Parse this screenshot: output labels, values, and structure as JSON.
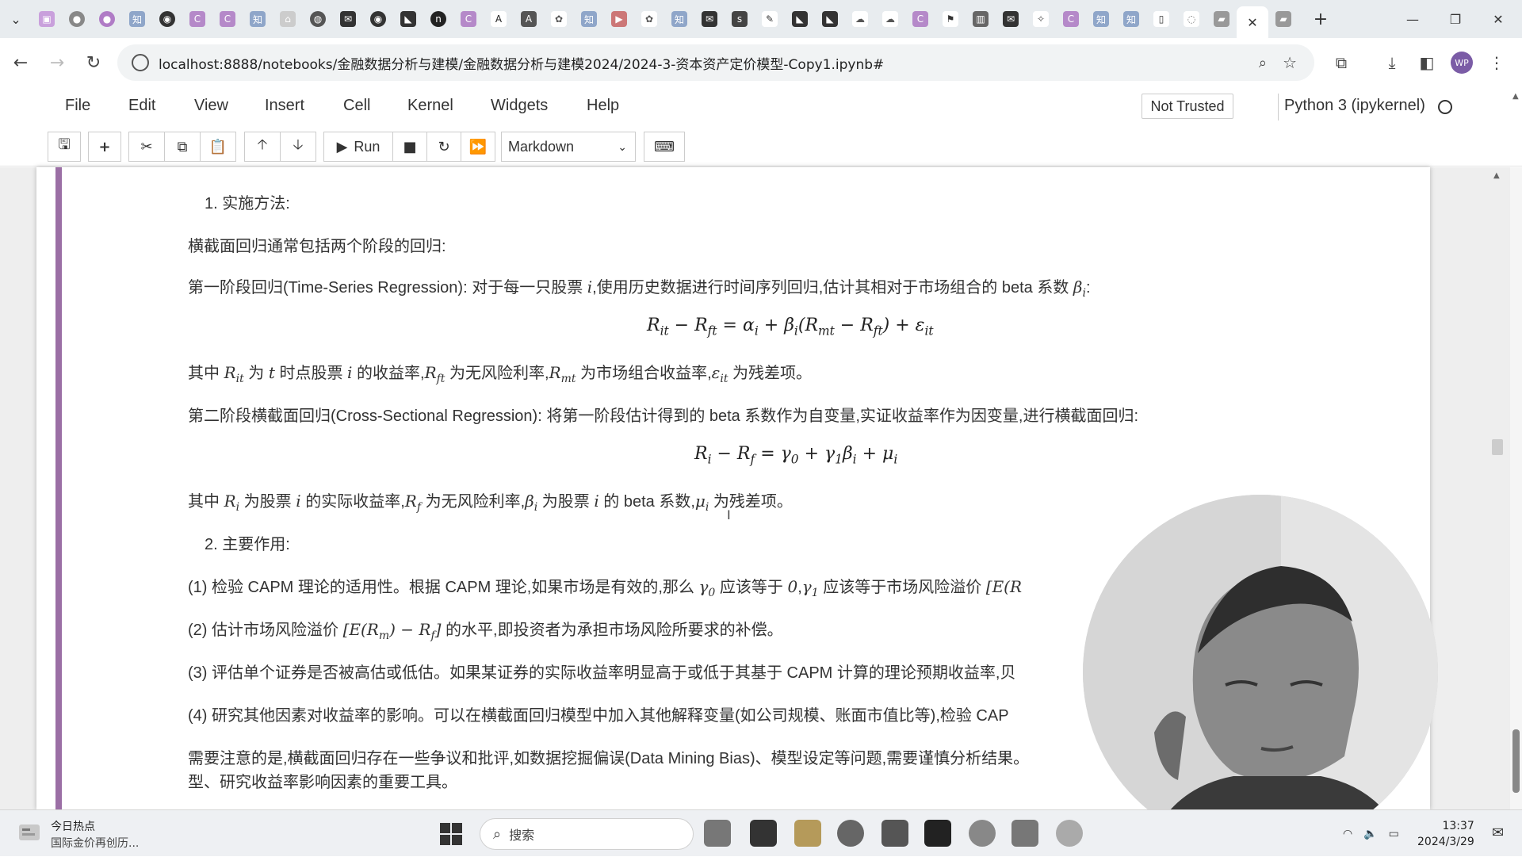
{
  "browser": {
    "url": "localhost:8888/notebooks/金融数据分析与建模/金融数据分析与建模2024/2024-3-资本资产定价模型-Copy1.ipynb#",
    "profile_initials": "WP",
    "active_tab_close": "✕",
    "new_tab": "+"
  },
  "menu": [
    "File",
    "Edit",
    "View",
    "Insert",
    "Cell",
    "Kernel",
    "Widgets",
    "Help"
  ],
  "status": {
    "trusted": "Not Trusted",
    "kernel": "Python 3 (ipykernel)"
  },
  "toolbar": {
    "run_label": "Run",
    "cell_type": "Markdown"
  },
  "content": {
    "h1": "1. 实施方法:",
    "p1": "横截面回归通常包括两个阶段的回归:",
    "p2_a": "第一阶段回归(Time-Series Regression): 对于每一只股票 ",
    "p2_b": "i",
    "p2_c": ",使用历史数据进行时间序列回归,估计其相对于市场组合的 beta 系数 ",
    "p2_d": "β",
    "p2_e": "i",
    "p2_f": ":",
    "eq1": "R_it − R_ft = α_i + β_i(R_mt − R_ft) + ε_it",
    "p3": "其中 R_it 为 t 时点股票 i 的收益率,R_ft 为无风险利率,R_mt 为市场组合收益率,ε_it 为残差项。",
    "p4": "第二阶段横截面回归(Cross-Sectional Regression): 将第一阶段估计得到的 beta 系数作为自变量,实证收益率作为因变量,进行横截面回归:",
    "eq2": "R_i − R_f = γ_0 + γ_1β_i + μ_i",
    "p5": "其中 R_i 为股票 i 的实际收益率,R_f 为无风险利率,β_i 为股票 i 的 beta 系数,μ_i 为残差项。",
    "h2": "2. 主要作用:",
    "l1": "(1) 检验 CAPM 理论的适用性。根据 CAPM 理论,如果市场是有效的,那么 γ_0 应该等于 0,γ_1 应该等于市场风险溢价 [E(R",
    "l2": "(2) 估计市场风险溢价 [E(R_m) − R_f] 的水平,即投资者为承担市场风险所要求的补偿。",
    "l3": "(3) 评估单个证券是否被高估或低估。如果某证券的实际收益率明显高于或低于其基于 CAPM 计算的理论预期收益率,贝",
    "l4": "(4) 研究其他因素对收益率的影响。可以在横截面回归模型中加入其他解释变量(如公司规模、账面市值比等),检验 CAP",
    "p6": "需要注意的是,横截面回归存在一些争议和批评,如数据挖掘偏误(Data Mining Bias)、模型设定等问题,需要谨慎分析结果。",
    "p7": "型、研究收益率影响因素的重要工具。"
  },
  "taskbar": {
    "news_title": "今日热点",
    "news_sub": "国际金价再创历...",
    "search_placeholder": "搜索",
    "time": "13:37",
    "date": "2024/3/29"
  },
  "colors": {
    "cell_bar": "#9b6fa5",
    "tab_bg": "#e8ecef",
    "avatar": "#7b5ca6"
  }
}
